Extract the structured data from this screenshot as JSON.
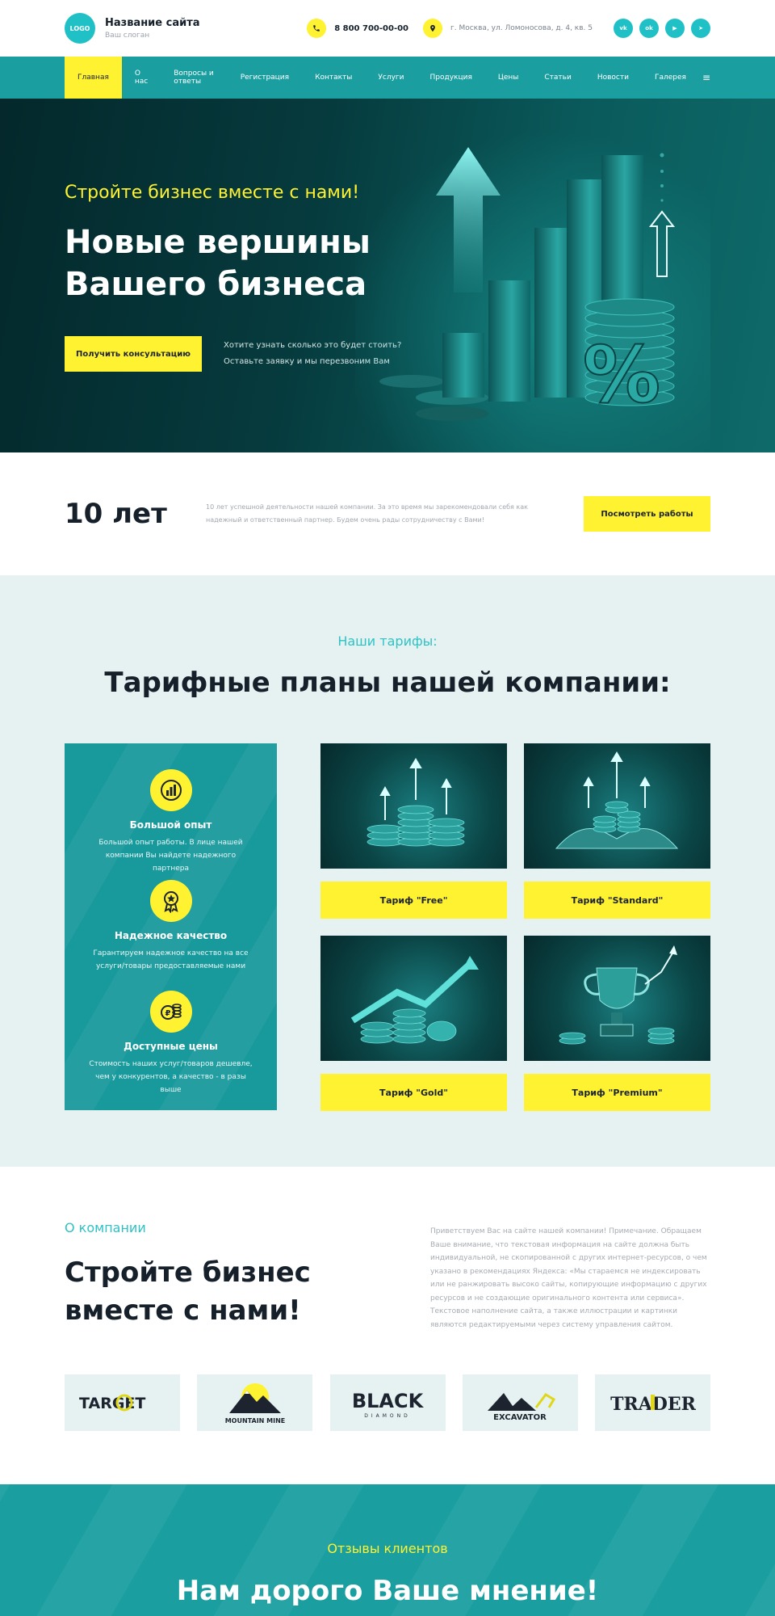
{
  "header": {
    "logo": "LOGO",
    "site_name": "Название сайта",
    "slogan": "Ваш слоган",
    "phone": "8 800 700-00-00",
    "address": "г. Москва, ул. Ломоносова, д. 4, кв. 5",
    "socials": [
      {
        "label": "vk",
        "icon": "vk-icon"
      },
      {
        "label": "ok",
        "icon": "odnoklassniki-icon"
      },
      {
        "label": "▶",
        "icon": "youtube-icon"
      },
      {
        "label": "➤",
        "icon": "telegram-icon"
      }
    ]
  },
  "nav": {
    "items": [
      "Главная",
      "О нас",
      "Вопросы и ответы",
      "Регистрация",
      "Контакты",
      "Услуги",
      "Продукция",
      "Цены",
      "Статьи",
      "Новости",
      "Галерея"
    ],
    "menu_icon": "≡"
  },
  "hero": {
    "subtitle": "Стройте бизнес вместе с нами!",
    "title_line1": "Новые вершины",
    "title_line2": "Вашего бизнеса",
    "cta": "Получить консультацию",
    "note_line1": "Хотите узнать сколько это будет стоить?",
    "note_line2": "Оставьте заявку и мы перезвоним Вам",
    "art_symbol": "%"
  },
  "stats": {
    "years": "10 лет",
    "text": "10 лет успешной деятельности нашей компании. За это время мы зарекомендовали себя как надежный и ответственный партнер. Будем очень рады сотрудничеству с Вами!",
    "button": "Посмотреть работы"
  },
  "tariffs": {
    "subtitle": "Наши тарифы:",
    "title": "Тарифные планы нашей компании:",
    "features": [
      {
        "title": "Большой опыт",
        "text": "Большой опыт работы. В лице нашей компании Вы найдете надежного партнера",
        "icon": "growth-chart-icon"
      },
      {
        "title": "Надежное качество",
        "text": "Гарантируем надежное качество на все услуги/товары предоставляемые нами",
        "icon": "award-medal-icon"
      },
      {
        "title": "Доступные цены",
        "text": "Стоимость наших услуг/товаров дешевле, чем у конкурентов, а качество - в разы выше",
        "icon": "coins-icon"
      }
    ],
    "plans": [
      "Тариф \"Free\"",
      "Тариф \"Standard\"",
      "Тариф \"Gold\"",
      "Тариф \"Premium\""
    ]
  },
  "about": {
    "subtitle": "О компании",
    "title_line1": "Стройте бизнес",
    "title_line2": "вместе с нами!",
    "text": "Приветствуем Вас на сайте нашей компании! Примечание. Обращаем Ваше внимание, что текстовая информация на сайте должна быть индивидуальной, не скопированной с других интернет-ресурсов, о чем указано в рекомендациях Яндекса: «Мы стараемся не индексировать или не ранжировать высоко сайты, копирующие информацию с других ресурсов и не создающие оригинального контента или сервиса». Текстовое наполнение сайта, а также иллюстрации и картинки являются редактируемыми через систему управления сайтом.",
    "partners": [
      {
        "name": "TARGET"
      },
      {
        "name": "MOUNTAIN MINE"
      },
      {
        "name": "BLACK",
        "tagline": "DIAMOND"
      },
      {
        "name": "EXCAVATOR"
      },
      {
        "name": "TRADER"
      }
    ]
  },
  "reviews": {
    "subtitle": "Отзывы клиентов",
    "title": "Нам дорого Ваше мнение!"
  },
  "colors": {
    "accent_yellow": "#fff231",
    "teal": "#1a9ea0",
    "teal_light": "#2ec2c5",
    "panel_bg": "#e6f2f1",
    "text_dark": "#15202b"
  }
}
